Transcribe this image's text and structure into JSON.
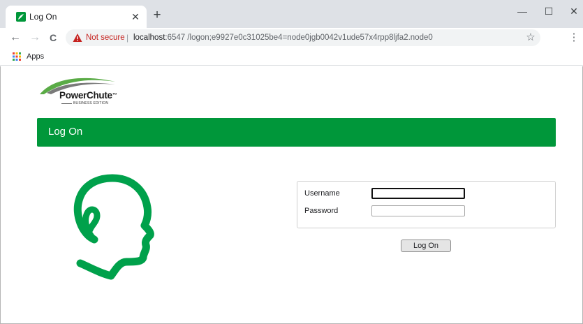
{
  "browser": {
    "tab": {
      "title": "Log On",
      "close": "✕",
      "favicon_color": "#00973a"
    },
    "new_tab": "+",
    "window_controls": {
      "minimize": "—",
      "maximize": "☐",
      "close": "✕"
    },
    "nav": {
      "back": "←",
      "forward": "→",
      "reload": "C"
    },
    "omnibox": {
      "security_label": "Not secure",
      "separator": "|",
      "url_host": "localhost",
      "url_rest": ":6547 /logon;e9927e0c31025be4=node0jgb0042v1ude57x4rpp8ljfa2.node0"
    },
    "bookmark_star": "☆",
    "menu": "⋮",
    "bookmarks_bar": {
      "apps_label": "Apps"
    }
  },
  "page": {
    "logo": {
      "name": "PowerChute",
      "tm": "™",
      "edition": "BUSINESS EDITION"
    },
    "header_title": "Log On",
    "form": {
      "username_label": "Username",
      "username_value": "",
      "password_label": "Password",
      "password_value": "",
      "submit_label": "Log On"
    }
  },
  "colors": {
    "brand_green": "#00973a",
    "chrome_bg": "#dee1e6",
    "warning_red": "#c5221f"
  },
  "icons": {
    "favicon": "powerchute-leaf-icon",
    "warning": "warning-triangle-icon",
    "apps": "apps-grid-icon",
    "head_graphic": "head-profile-icon"
  }
}
